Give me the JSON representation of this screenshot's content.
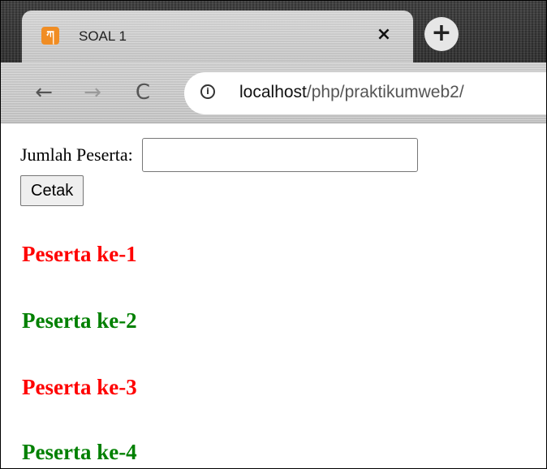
{
  "browser": {
    "tab_title": "SOAL 1",
    "tab_icon": "xampp-icon",
    "close_glyph": "×",
    "new_tab_glyph": "+",
    "url_host": "localhost",
    "url_path": "/php/praktikumweb2/",
    "nav": {
      "back": "←",
      "forward": "→",
      "reload": "C"
    }
  },
  "form": {
    "label": "Jumlah Peserta:",
    "input_value": "",
    "button_label": "Cetak"
  },
  "results": [
    {
      "text": "Peserta ke-1",
      "color": "#ff0000"
    },
    {
      "text": "Peserta ke-2",
      "color": "#008000"
    },
    {
      "text": "Peserta ke-3",
      "color": "#ff0000"
    },
    {
      "text": "Peserta ke-4",
      "color": "#008000"
    }
  ]
}
